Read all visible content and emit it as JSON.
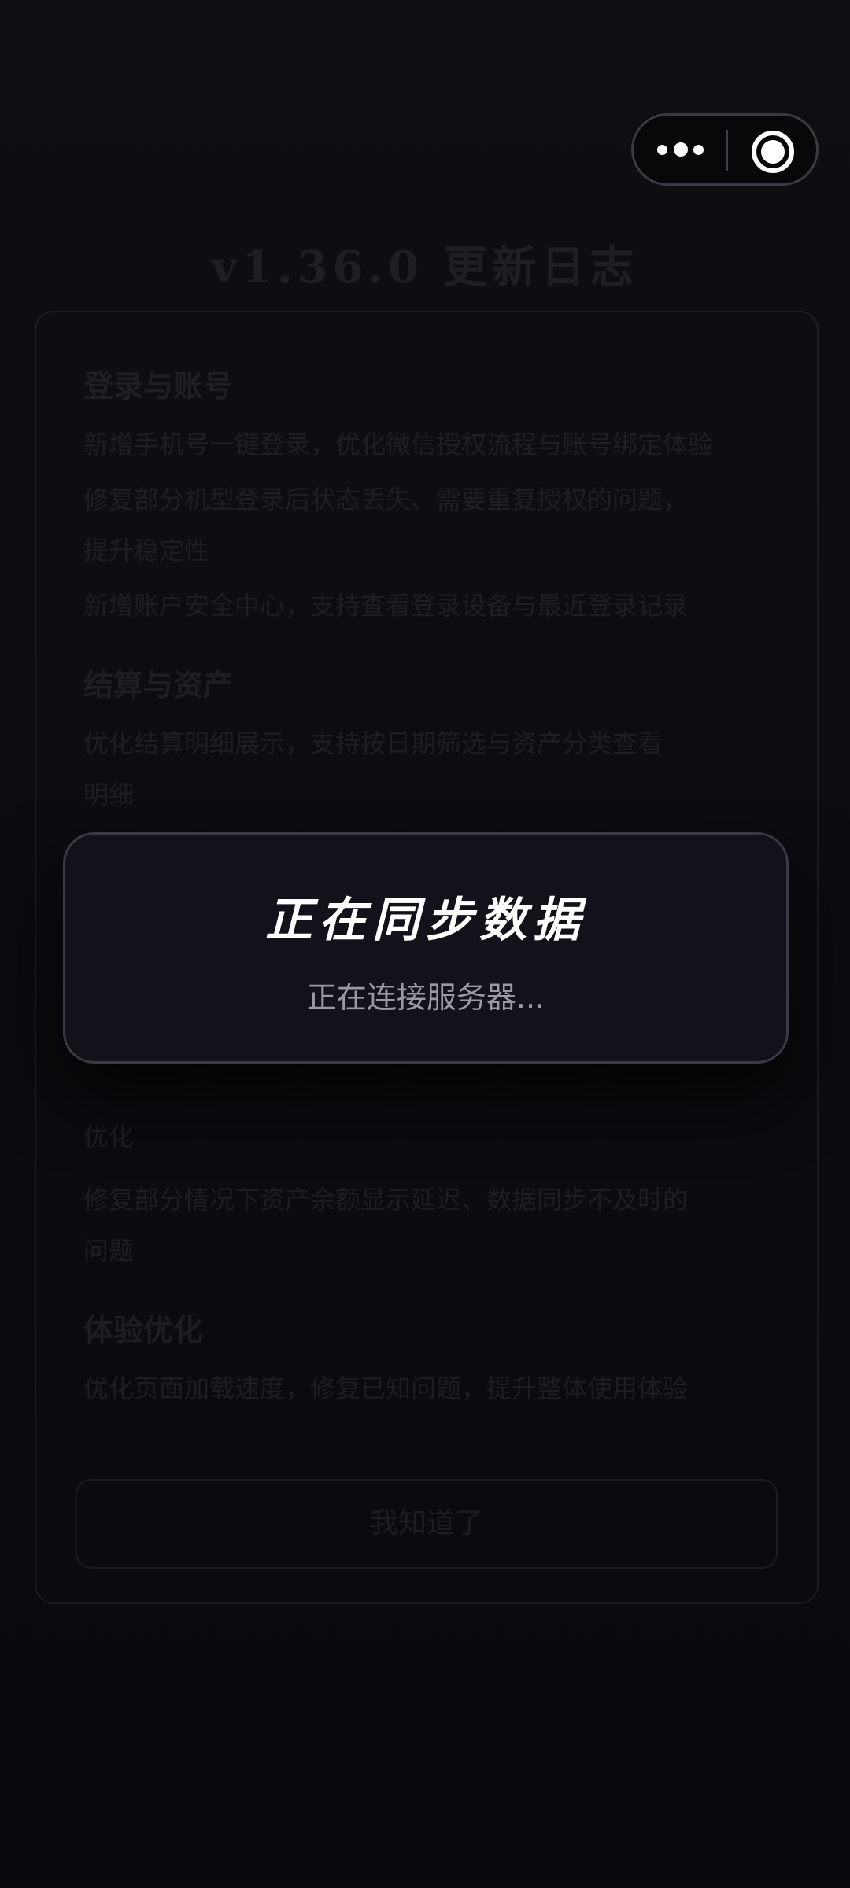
{
  "background_page": {
    "title": "v1.36.0 更新日志",
    "sections": [
      {
        "heading": "登录与账号",
        "lines": [
          "新增手机号一键登录，优化微信授权流程与账号绑定体验",
          "修复部分机型登录后状态丢失、需要重复授权的问题，",
          "提升稳定性",
          "新增账户安全中心，支持查看登录设备与最近登录记录"
        ]
      },
      {
        "heading": "结算与资产",
        "lines": [
          "优化结算明细展示，支持按日期筛选与资产分类查看",
          "明细"
        ]
      },
      {
        "heading": "",
        "lines": [
          "优化",
          "修复部分情况下资产余额显示延迟、数据同步不及时的",
          "问题"
        ]
      },
      {
        "heading": "体验优化",
        "lines": [
          "优化页面加载速度，修复已知问题，提升整体使用体验"
        ]
      }
    ],
    "button_label": "我知道了"
  },
  "dialog": {
    "title": "正在同步数据",
    "message": "正在连接服务器..."
  },
  "capsule": {
    "more_icon": "more-dots-icon",
    "close_icon": "target-circle-icon"
  }
}
